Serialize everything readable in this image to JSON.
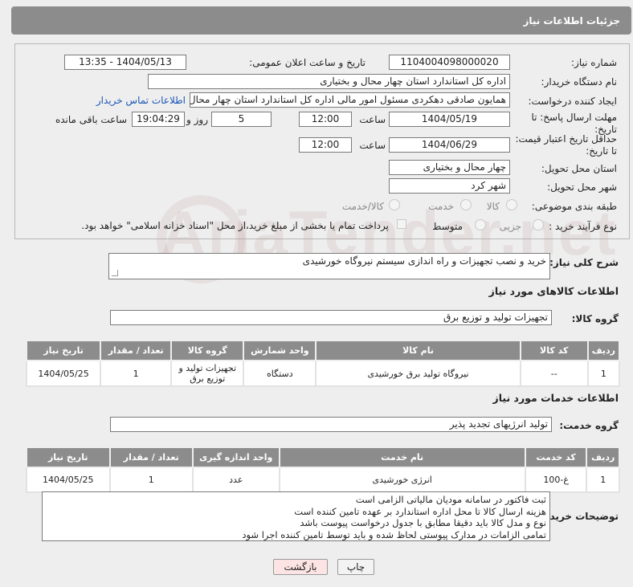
{
  "header": {
    "title": "جزئیات اطلاعات نیاز"
  },
  "form": {
    "need_number_label": "شماره نیاز:",
    "need_number": "1104004098000020",
    "announce_label": "تاریخ و ساعت اعلان عمومی:",
    "announce_value": "1404/05/13 - 13:35",
    "buyer_org_label": "نام دستگاه خریدار:",
    "buyer_org": "اداره کل استاندارد استان چهار محال و بختیاری",
    "creator_label": "ایجاد کننده درخواست:",
    "creator": "همایون صادقی دهکردی مسئول امور مالی اداره کل استاندارد استان چهار محال",
    "contact_link": "اطلاعات تماس خریدار",
    "reply_deadline_label": "مهلت ارسال پاسخ: تا تاریخ:",
    "reply_date": "1404/05/19",
    "time_label": "ساعت",
    "reply_time": "12:00",
    "days_value": "5",
    "days_label": "روز و",
    "remaining_time": "19:04:29",
    "remaining_label": "ساعت باقی مانده",
    "price_validity_label": "حداقل تاریخ اعتبار قیمت: تا تاریخ:",
    "price_date": "1404/06/29",
    "price_time": "12:00",
    "province_label": "استان محل تحویل:",
    "province": "چهار محال و بختیاری",
    "city_label": "شهر محل تحویل:",
    "city": "شهر کرد",
    "category_label": "طبقه بندی موضوعی:",
    "category_options": [
      "کالا",
      "خدمت",
      "کالا/خدمت"
    ],
    "purchase_type_label": "نوع فرآیند خرید :",
    "purchase_options": [
      "جزیی",
      "متوسط"
    ],
    "payment_note": "پرداخت تمام یا بخشی از مبلغ خرید،از محل \"اسناد خزانه اسلامی\" خواهد بود."
  },
  "description": {
    "label": "شرح کلی نیاز:",
    "text": "خرید و نصب تجهیزات و راه اندازی سیستم نیروگاه خورشیدی"
  },
  "goods": {
    "section_title": "اطلاعات کالاهای مورد نیاز",
    "group_label": "گروه کالا:",
    "group_value": "تجهیزات تولید و توزیع برق",
    "columns": [
      "ردیف",
      "کد کالا",
      "نام کالا",
      "واحد شمارش",
      "گروه کالا",
      "تعداد / مقدار",
      "تاریخ نیاز"
    ],
    "rows": [
      [
        "1",
        "--",
        "نیروگاه تولید برق خورشیدی",
        "دستگاه",
        "تجهیزات تولید و توزیع برق",
        "1",
        "1404/05/25"
      ]
    ]
  },
  "services": {
    "section_title": "اطلاعات خدمات مورد نیاز",
    "group_label": "گروه خدمت:",
    "group_value": "تولید انرژیهای تجدید پذیر",
    "columns": [
      "ردیف",
      "کد خدمت",
      "نام خدمت",
      "واحد اندازه گیری",
      "تعداد / مقدار",
      "تاریخ نیاز"
    ],
    "rows": [
      [
        "1",
        "غ-100",
        "انرژی خورشیدی",
        "عدد",
        "1",
        "1404/05/25"
      ]
    ]
  },
  "buyer_notes": {
    "label": "توضیحات خریدار:",
    "lines": [
      "ثبت فاکتور در سامانه مودیان مالیاتی الزامی است",
      "هزینه ارسال کالا تا محل اداره استاندارد بر عهده تامین کننده است",
      "نوع و مدل کالا باید دقیقا مطابق با جدول درخواست پیوست باشد",
      "تمامی الزامات در مدارک پیوستی لحاظ شده و باید توسط تامین کننده اجرا شود"
    ]
  },
  "buttons": {
    "print": "چاپ",
    "back": "بازگشت"
  },
  "watermark": "AriaTender.net",
  "colors": {
    "header": "#8c8c8c",
    "link": "#1a56b8",
    "back_button_bg": "#fde4e4"
  }
}
